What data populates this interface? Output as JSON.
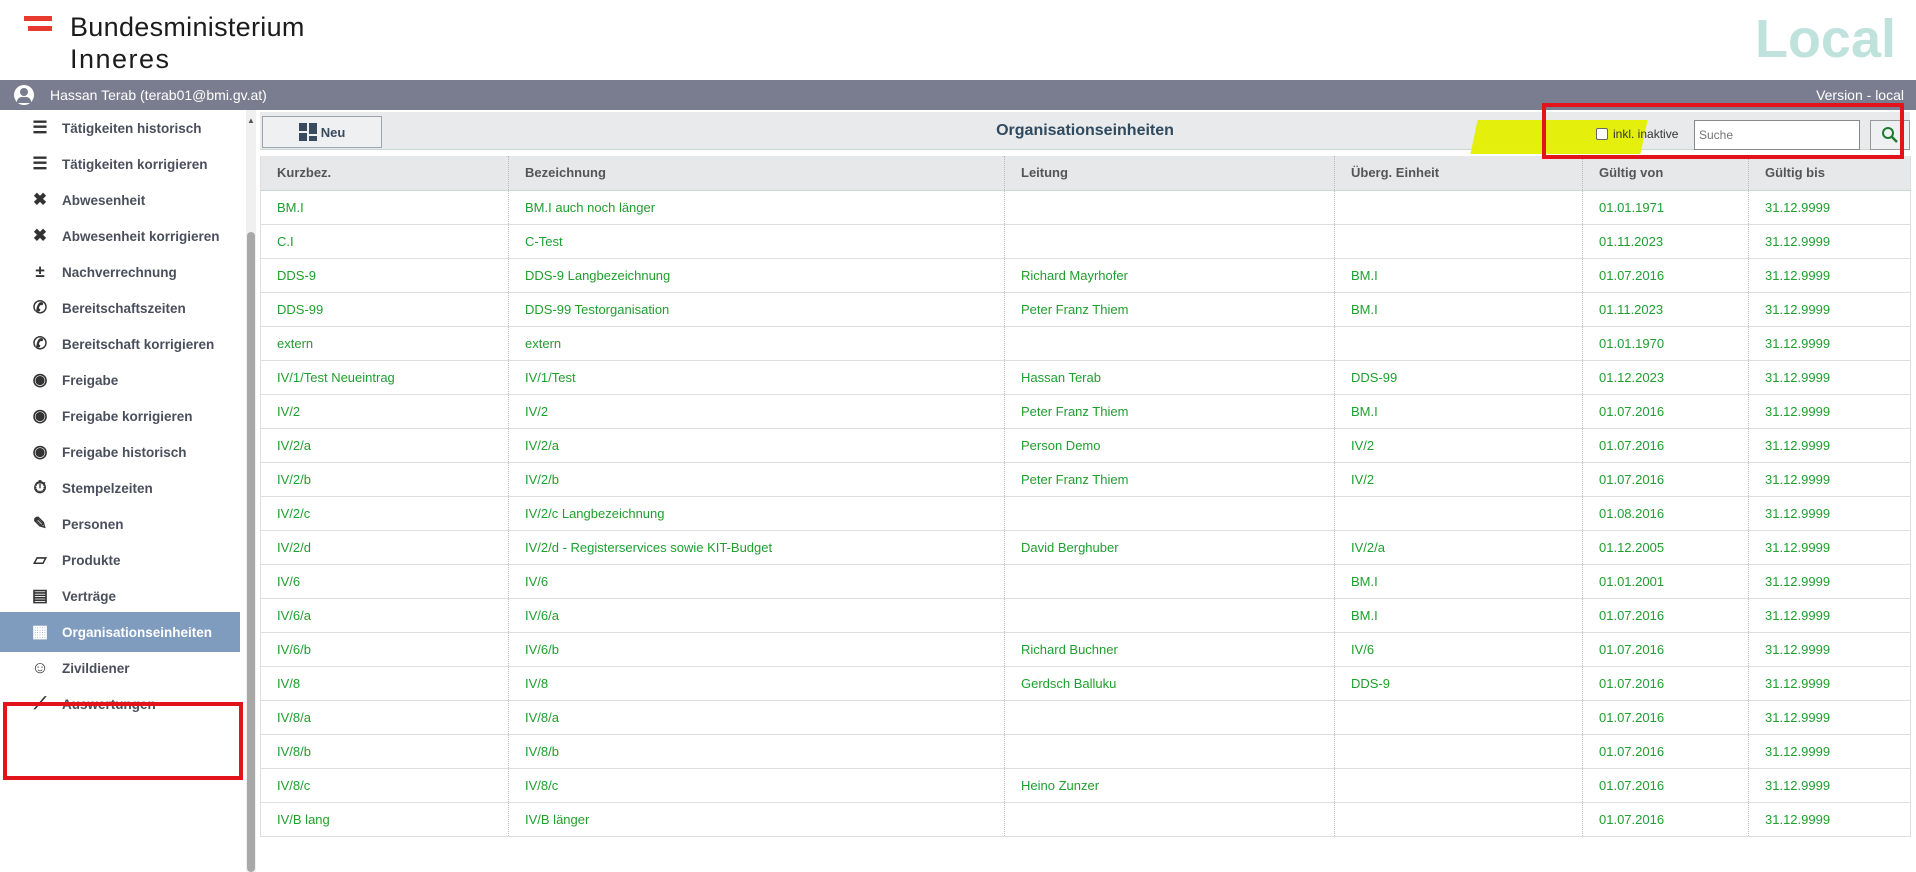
{
  "header": {
    "brand_line1": "Bundesministerium",
    "brand_line2": "Inneres",
    "environment": "Local"
  },
  "userbar": {
    "user": "Hassan Terab (terab01@bmi.gv.at)",
    "version": "Version - local"
  },
  "sidebar": {
    "items": [
      {
        "label": "Tätigkeiten historisch",
        "icon": "list-history-icon"
      },
      {
        "label": "Tätigkeiten korrigieren",
        "icon": "list-check-icon"
      },
      {
        "label": "Abwesenheit",
        "icon": "person-remove-icon"
      },
      {
        "label": "Abwesenheit korrigieren",
        "icon": "person-remove-icon"
      },
      {
        "label": "Nachverrechnung",
        "icon": "plus-minus-icon"
      },
      {
        "label": "Bereitschaftszeiten",
        "icon": "phone-icon"
      },
      {
        "label": "Bereitschaft korrigieren",
        "icon": "phone-list-icon"
      },
      {
        "label": "Freigabe",
        "icon": "eye-icon"
      },
      {
        "label": "Freigabe korrigieren",
        "icon": "eye-edit-icon"
      },
      {
        "label": "Freigabe historisch",
        "icon": "eye-history-icon"
      },
      {
        "label": "Stempelzeiten",
        "icon": "timer-icon"
      },
      {
        "label": "Personen",
        "icon": "person-edit-icon"
      },
      {
        "label": "Produkte",
        "icon": "cards-icon"
      },
      {
        "label": "Verträge",
        "icon": "document-icon"
      },
      {
        "label": "Organisationseinheiten",
        "icon": "dashboard-icon",
        "active": true
      },
      {
        "label": "Zivildiener",
        "icon": "people-icon"
      },
      {
        "label": "Auswertungen",
        "icon": "line-chart-icon"
      }
    ]
  },
  "toolbar": {
    "new_label": "Neu",
    "title": "Organisationseinheiten",
    "inactive_label": "inkl. inaktive",
    "search_placeholder": "Suche"
  },
  "table": {
    "columns": [
      "Kurzbez.",
      "Bezeichnung",
      "Leitung",
      "Überg. Einheit",
      "Gültig von",
      "Gültig bis"
    ],
    "rows": [
      [
        "BM.I",
        "BM.I auch noch länger",
        "",
        "",
        "01.01.1971",
        "31.12.9999"
      ],
      [
        "C.I",
        "C-Test",
        "",
        "",
        "01.11.2023",
        "31.12.9999"
      ],
      [
        "DDS-9",
        "DDS-9 Langbezeichnung",
        "Richard Mayrhofer",
        "BM.I",
        "01.07.2016",
        "31.12.9999"
      ],
      [
        "DDS-99",
        "DDS-99 Testorganisation",
        "Peter Franz Thiem",
        "BM.I",
        "01.11.2023",
        "31.12.9999"
      ],
      [
        "extern",
        "extern",
        "",
        "",
        "01.01.1970",
        "31.12.9999"
      ],
      [
        "IV/1/Test Neueintrag",
        "IV/1/Test",
        "Hassan Terab",
        "DDS-99",
        "01.12.2023",
        "31.12.9999"
      ],
      [
        "IV/2",
        "IV/2",
        "Peter Franz Thiem",
        "BM.I",
        "01.07.2016",
        "31.12.9999"
      ],
      [
        "IV/2/a",
        "IV/2/a",
        "Person Demo",
        "IV/2",
        "01.07.2016",
        "31.12.9999"
      ],
      [
        "IV/2/b",
        "IV/2/b",
        "Peter Franz Thiem",
        "IV/2",
        "01.07.2016",
        "31.12.9999"
      ],
      [
        "IV/2/c",
        "IV/2/c Langbezeichnung",
        "",
        "",
        "01.08.2016",
        "31.12.9999"
      ],
      [
        "IV/2/d",
        "IV/2/d - Registerservices sowie KIT-Budget",
        "David Berghuber",
        "IV/2/a",
        "01.12.2005",
        "31.12.9999"
      ],
      [
        "IV/6",
        "IV/6",
        "",
        "BM.I",
        "01.01.2001",
        "31.12.9999"
      ],
      [
        "IV/6/a",
        "IV/6/a",
        "",
        "BM.I",
        "01.07.2016",
        "31.12.9999"
      ],
      [
        "IV/6/b",
        "IV/6/b",
        "Richard Buchner",
        "IV/6",
        "01.07.2016",
        "31.12.9999"
      ],
      [
        "IV/8",
        "IV/8",
        "Gerdsch Balluku",
        "DDS-9",
        "01.07.2016",
        "31.12.9999"
      ],
      [
        "IV/8/a",
        "IV/8/a",
        "",
        "",
        "01.07.2016",
        "31.12.9999"
      ],
      [
        "IV/8/b",
        "IV/8/b",
        "",
        "",
        "01.07.2016",
        "31.12.9999"
      ],
      [
        "IV/8/c",
        "IV/8/c",
        "Heino Zunzer",
        "",
        "01.07.2016",
        "31.12.9999"
      ],
      [
        "IV/B lang",
        "IV/B länger",
        "",
        "",
        "01.07.2016",
        "31.12.9999"
      ]
    ]
  },
  "colors": {
    "accent_green": "#1e9f2e",
    "active_sidebar": "#7f9bbd",
    "userbar": "#7a7d8f",
    "annotation_red": "#e3131b",
    "annotation_yellow": "#e4f000"
  }
}
